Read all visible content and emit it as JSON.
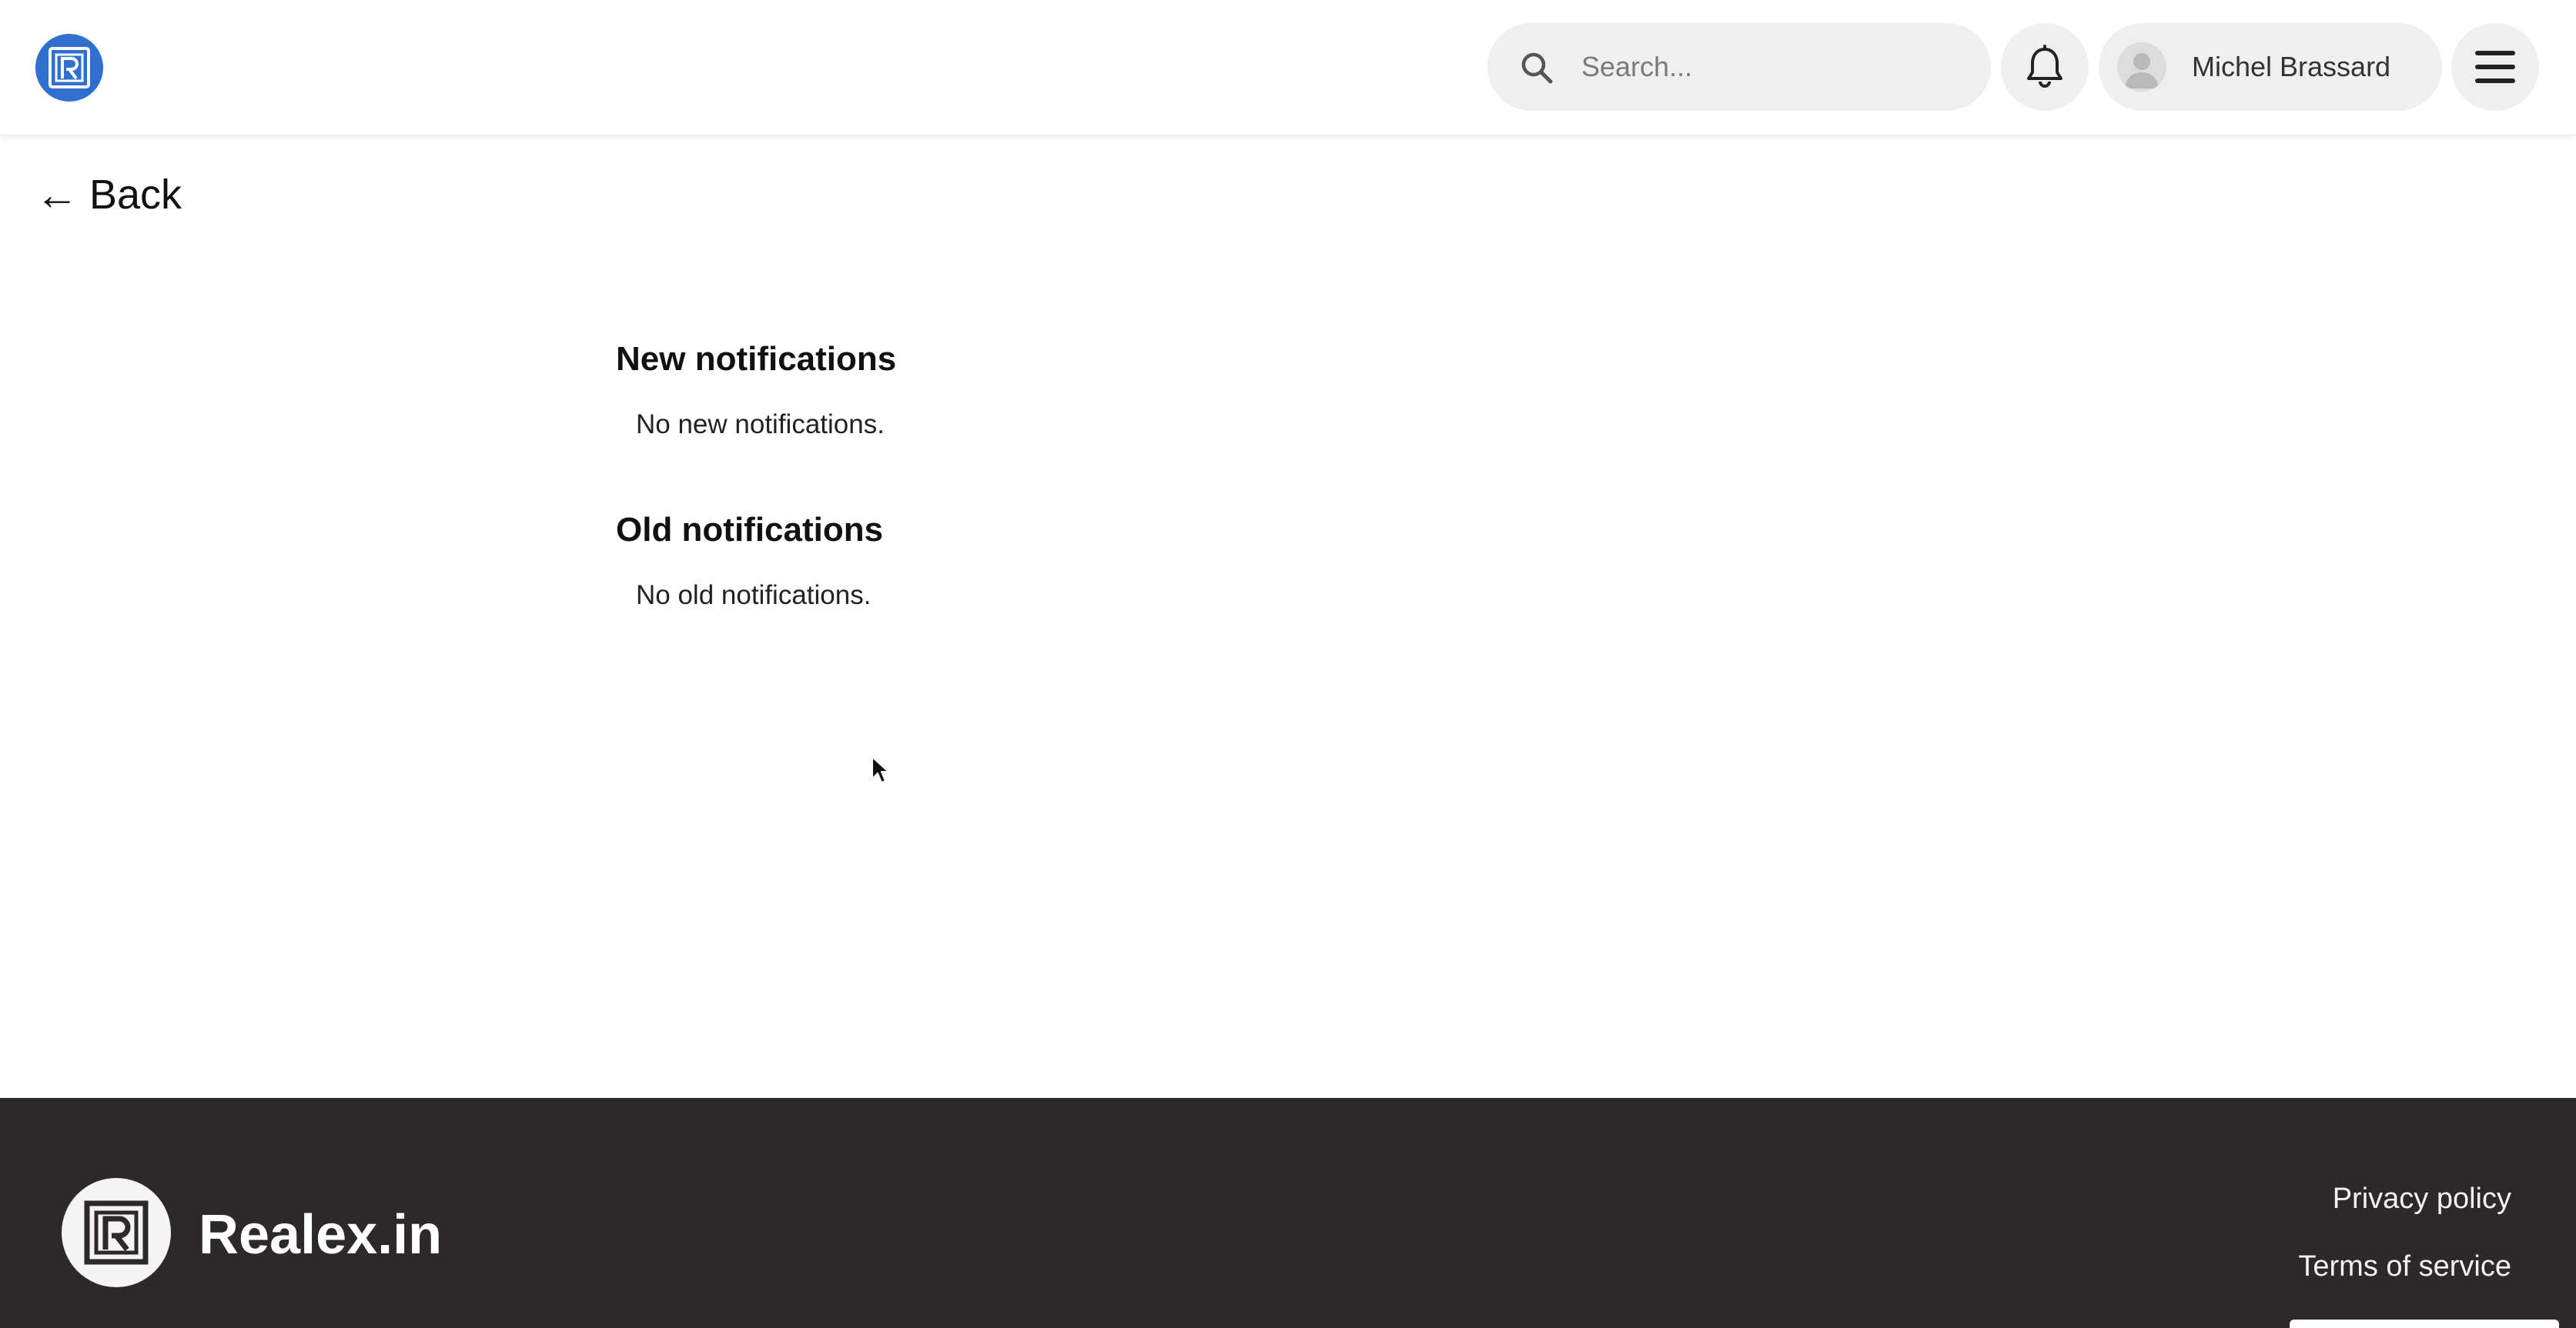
{
  "header": {
    "logo_icon": "realex-logo-icon",
    "search": {
      "placeholder": "Search...",
      "value": "",
      "icon": "search-icon"
    },
    "notifications_icon": "bell-icon",
    "user": {
      "name": "Michel Brassard",
      "avatar_icon": "user-avatar-icon"
    },
    "menu_icon": "hamburger-menu-icon"
  },
  "back": {
    "arrow": "←",
    "label": "Back"
  },
  "notifications": {
    "new": {
      "title": "New notifications",
      "empty_text": "No new notifications."
    },
    "old": {
      "title": "Old notifications",
      "empty_text": "No old notifications."
    }
  },
  "footer": {
    "brand": "Realex.in",
    "links": {
      "privacy": "Privacy policy",
      "terms": "Terms of service"
    }
  },
  "colors": {
    "brand_blue": "#2f6fd0",
    "footer_bg": "#2d292b",
    "pill_bg": "#efefef"
  }
}
